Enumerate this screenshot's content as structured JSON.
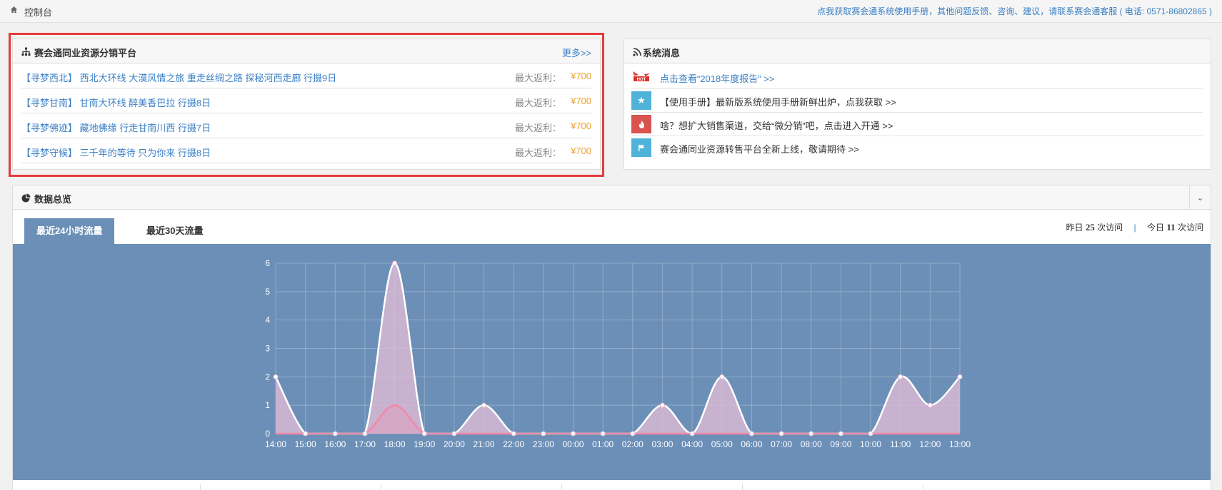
{
  "topbar": {
    "crumb": "控制台",
    "notice": "点我获取赛会通系统使用手册，其他问题反馈、咨询、建议，请联系赛会通客服 ( 电话: 0571-86802865 )"
  },
  "dist": {
    "title": "赛会通同业资源分销平台",
    "more": "更多>>",
    "rows": [
      {
        "title": "【寻梦西北】 西北大环线 大漠风情之旅 重走丝绸之路 探秘河西走廊 行摄9日",
        "label": "最大返利：",
        "value": "¥700"
      },
      {
        "title": "【寻梦甘南】 甘南大环线 醉美香巴拉 行摄8日",
        "label": "最大返利：",
        "value": "¥700"
      },
      {
        "title": "【寻梦佛迹】 藏地佛缘 行走甘南川西 行摄7日",
        "label": "最大返利：",
        "value": "¥700"
      },
      {
        "title": "【寻梦守候】 三千年的等待 只为你来 行摄8日",
        "label": "最大返利：",
        "value": "¥700"
      }
    ]
  },
  "msgs": {
    "title": "系统消息",
    "rows": [
      {
        "icon": "hot-badge-icon",
        "text": "点击查看“2018年度报告” >>"
      },
      {
        "icon": "star-icon",
        "color": "#4fb3d9",
        "text": "【使用手册】最新版系统使用手册新鲜出炉，点我获取 >>"
      },
      {
        "icon": "fire-icon",
        "color": "#d9534f",
        "text": "啥？想扩大销售渠道，交给“微分销”吧，点击进入开通 >>"
      },
      {
        "icon": "flag-icon",
        "color": "#4fb3d9",
        "text": "赛会通同业资源转售平台全新上线，敬请期待 >>"
      }
    ]
  },
  "overview": {
    "title": "数据总览",
    "tabs": [
      "最近24小时流量",
      "最近30天流量"
    ],
    "stats": {
      "yesterday_prefix": "昨日",
      "yesterday": "25",
      "today_prefix": "今日",
      "today": "11",
      "suffix": "次访问",
      "sep": "|"
    }
  },
  "colors": {
    "link": "#3a7fc5",
    "accent": "#f0a02a",
    "chart_bg": "#6b8fb7",
    "highlight_border": "#e53a3a"
  },
  "chart_data": {
    "type": "area",
    "categories": [
      "14:00",
      "15:00",
      "16:00",
      "17:00",
      "18:00",
      "19:00",
      "20:00",
      "21:00",
      "22:00",
      "23:00",
      "00:00",
      "01:00",
      "02:00",
      "03:00",
      "04:00",
      "05:00",
      "06:00",
      "07:00",
      "08:00",
      "09:00",
      "10:00",
      "11:00",
      "12:00",
      "13:00"
    ],
    "series": [
      {
        "values": [
          2,
          0,
          0,
          0,
          6,
          0,
          0,
          1,
          0,
          0,
          0,
          0,
          0,
          1,
          0,
          2,
          0,
          0,
          0,
          0,
          0,
          2,
          1,
          2
        ],
        "color": "#ffffff"
      },
      {
        "values": [
          0,
          0,
          0,
          0,
          1,
          0,
          0,
          0,
          0,
          0,
          0,
          0,
          0,
          0,
          0,
          0,
          0,
          0,
          0,
          0,
          0,
          0,
          0,
          0
        ],
        "color": "#f08aa8"
      }
    ],
    "ylim": [
      0,
      6
    ],
    "yticks": [
      0,
      1,
      2,
      3,
      4,
      5,
      6
    ],
    "grid": true
  }
}
